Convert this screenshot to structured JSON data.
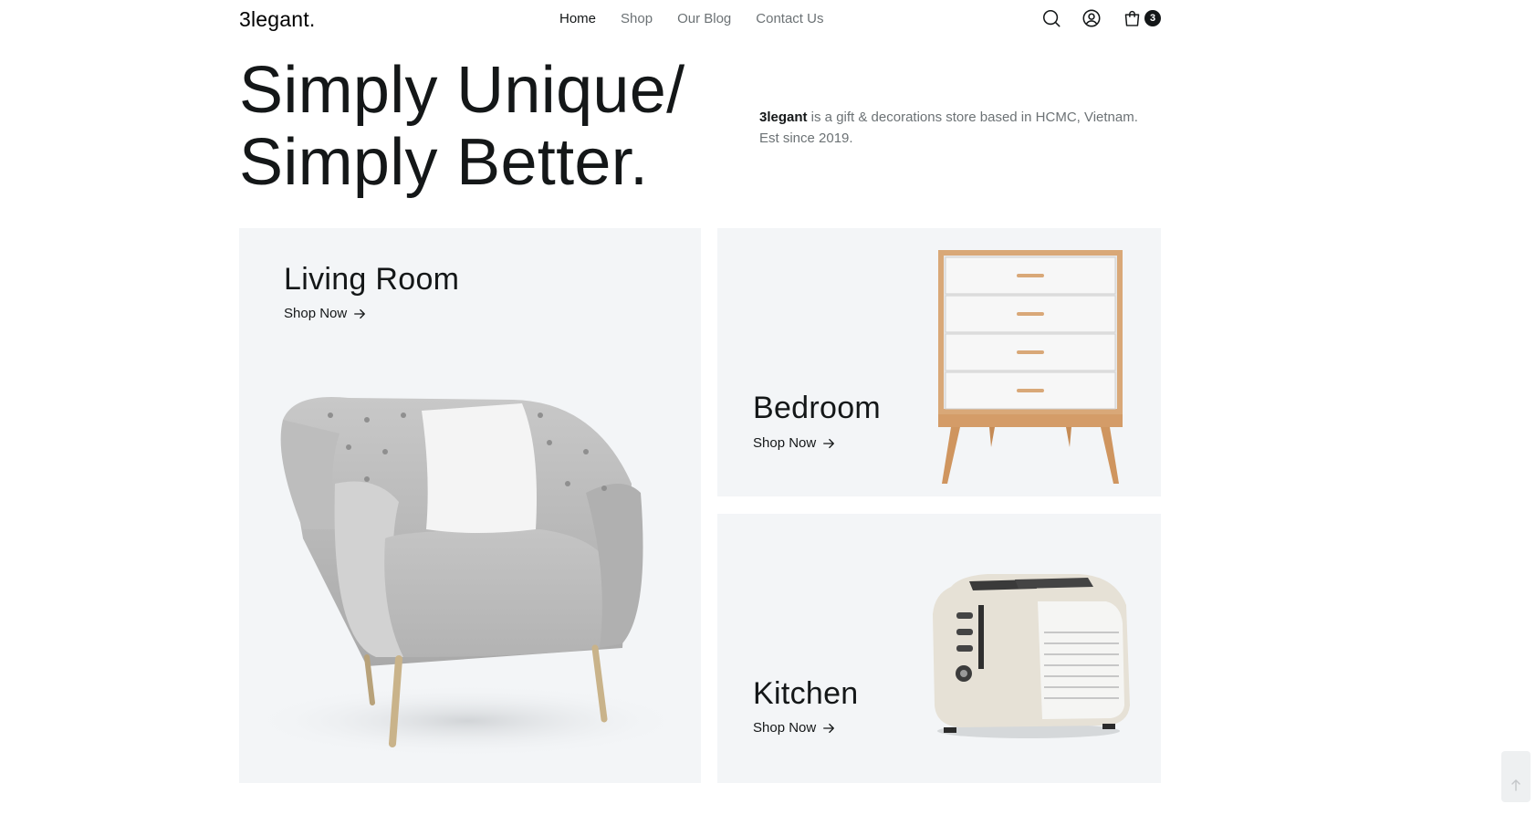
{
  "header": {
    "logo": "3legant.",
    "nav": [
      {
        "label": "Home",
        "active": true
      },
      {
        "label": "Shop",
        "active": false
      },
      {
        "label": "Our Blog",
        "active": false
      },
      {
        "label": "Contact Us",
        "active": false
      }
    ],
    "cart_count": "3",
    "icons": [
      "search-icon",
      "user-icon",
      "shopping-bag-icon"
    ]
  },
  "hero": {
    "title_line1": "Simply Unique/",
    "title_line2": "Simply Better.",
    "brand": "3legant",
    "description_rest": " is a gift & decorations store based in HCMC, Vietnam. Est since 2019."
  },
  "categories": [
    {
      "title": "Living Room",
      "link": "Shop Now"
    },
    {
      "title": "Bedroom",
      "link": "Shop Now"
    },
    {
      "title": "Kitchen",
      "link": "Shop Now"
    }
  ],
  "colors": {
    "text_primary": "#141718",
    "text_secondary": "#6c7275",
    "card_bg": "#f3f5f7",
    "badge_bg": "#141718"
  }
}
